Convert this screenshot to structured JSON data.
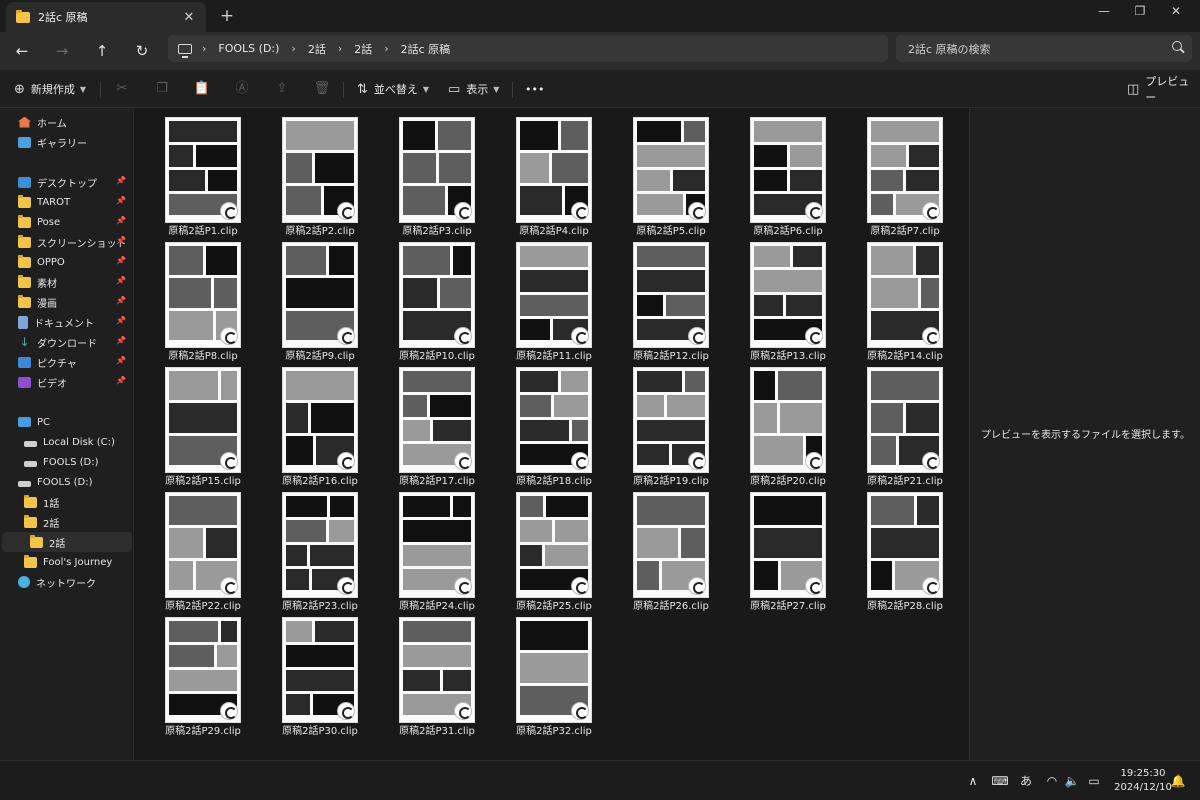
{
  "window": {
    "tab_title": "2話c 原稿",
    "new_tab": "+",
    "minimize": "—",
    "restore": "❐",
    "close": "✕"
  },
  "nav": {
    "back": "←",
    "forward": "→",
    "up": "↑",
    "refresh": "↻",
    "breadcrumb": [
      "FOOLS (D:)",
      "2話",
      "2話",
      "2話c 原稿"
    ],
    "breadcrumb_sep": "›",
    "search_placeholder": "2話c 原稿の検索"
  },
  "command_bar": {
    "new_label": "新規作成",
    "sort_label": "並べ替え",
    "view_label": "表示",
    "more_label": "•••",
    "preview_label": "プレビュー"
  },
  "sidebar": {
    "items": [
      {
        "label": "ホーム",
        "icon": "home-icon"
      },
      {
        "label": "ギャラリー",
        "icon": "gallery-icon"
      },
      {
        "label": "デスクトップ",
        "icon": "desktop-icon",
        "pinned": true
      },
      {
        "label": "TAROT",
        "icon": "folder-icon",
        "pinned": true
      },
      {
        "label": "Pose",
        "icon": "folder-icon",
        "pinned": true
      },
      {
        "label": "スクリーンショット",
        "icon": "folder-icon",
        "pinned": true
      },
      {
        "label": "OPPO",
        "icon": "folder-icon",
        "pinned": true
      },
      {
        "label": "素材",
        "icon": "folder-icon",
        "pinned": true
      },
      {
        "label": "漫画",
        "icon": "folder-icon",
        "pinned": true
      },
      {
        "label": "ドキュメント",
        "icon": "document-icon",
        "pinned": true
      },
      {
        "label": "ダウンロード",
        "icon": "download-icon",
        "pinned": true
      },
      {
        "label": "ピクチャ",
        "icon": "picture-icon",
        "pinned": true
      },
      {
        "label": "ビデオ",
        "icon": "video-icon",
        "pinned": true
      },
      {
        "label": "PC",
        "icon": "pc-icon"
      },
      {
        "label": "Local Disk (C:)",
        "icon": "drive-icon"
      },
      {
        "label": "FOOLS (D:)",
        "icon": "drive-icon"
      },
      {
        "label": "FOOLS (D:)",
        "icon": "drive-icon"
      },
      {
        "label": "1話",
        "icon": "folder-icon"
      },
      {
        "label": "2話",
        "icon": "folder-icon"
      },
      {
        "label": "2話",
        "icon": "folder-icon",
        "selected": true
      },
      {
        "label": "Fool's Journey",
        "icon": "folder-icon"
      },
      {
        "label": "ネットワーク",
        "icon": "network-icon"
      }
    ],
    "pin_glyph": "📌"
  },
  "files": [
    "原稿2話P1.clip",
    "原稿2話P2.clip",
    "原稿2話P3.clip",
    "原稿2話P4.clip",
    "原稿2話P5.clip",
    "原稿2話P6.clip",
    "原稿2話P7.clip",
    "原稿2話P8.clip",
    "原稿2話P9.clip",
    "原稿2話P10.clip",
    "原稿2話P11.clip",
    "原稿2話P12.clip",
    "原稿2話P13.clip",
    "原稿2話P14.clip",
    "原稿2話P15.clip",
    "原稿2話P16.clip",
    "原稿2話P17.clip",
    "原稿2話P18.clip",
    "原稿2話P19.clip",
    "原稿2話P20.clip",
    "原稿2話P21.clip",
    "原稿2話P22.clip",
    "原稿2話P23.clip",
    "原稿2話P24.clip",
    "原稿2話P25.clip",
    "原稿2話P26.clip",
    "原稿2話P27.clip",
    "原稿2話P28.clip",
    "原稿2話P29.clip",
    "原稿2話P30.clip",
    "原稿2話P31.clip",
    "原稿2話P32.clip"
  ],
  "preview": {
    "message": "プレビューを表示するファイルを選択します。"
  },
  "taskbar": {
    "chevron": "∧",
    "keyboard": "⌨",
    "ime": "あ",
    "wifi": "◠",
    "volume": "🔈",
    "battery": "▭",
    "time": "19:25:30",
    "date": "2024/12/10",
    "bell": "🔔"
  }
}
